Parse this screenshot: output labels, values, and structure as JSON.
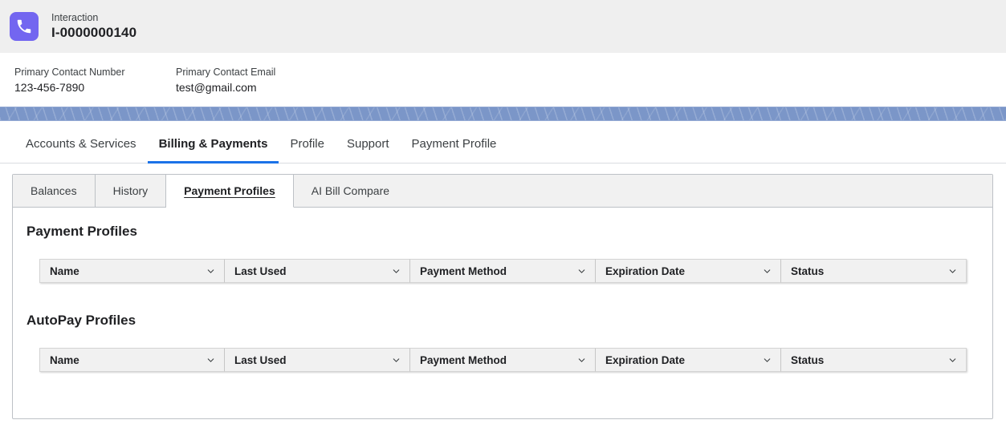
{
  "record_header": {
    "icon": "phone-icon",
    "eyebrow": "Interaction",
    "name": "I-0000000140",
    "icon_color": "#7366f0"
  },
  "contact": {
    "number_label": "Primary Contact Number",
    "number_value": "123-456-7890",
    "email_label": "Primary Contact Email",
    "email_value": "test@gmail.com"
  },
  "primary_nav": {
    "tabs": [
      {
        "label": "Accounts & Services",
        "active": false
      },
      {
        "label": "Billing & Payments",
        "active": true
      },
      {
        "label": "Profile",
        "active": false
      },
      {
        "label": "Support",
        "active": false
      },
      {
        "label": "Payment Profile",
        "active": false
      }
    ],
    "active_color": "#1b72e8"
  },
  "sub_tabs": {
    "tabs": [
      {
        "label": "Balances",
        "active": false
      },
      {
        "label": "History",
        "active": false
      },
      {
        "label": "Payment Profiles",
        "active": true
      },
      {
        "label": "AI Bill Compare",
        "active": false
      }
    ]
  },
  "sections": [
    {
      "title": "Payment Profiles",
      "columns": [
        "Name",
        "Last Used",
        "Payment Method",
        "Expiration Date",
        "Status"
      ],
      "rows": []
    },
    {
      "title": "AutoPay Profiles",
      "columns": [
        "Name",
        "Last Used",
        "Payment Method",
        "Expiration Date",
        "Status"
      ],
      "rows": []
    }
  ],
  "icons": {
    "sort_chevron": "chevron-down-icon"
  }
}
